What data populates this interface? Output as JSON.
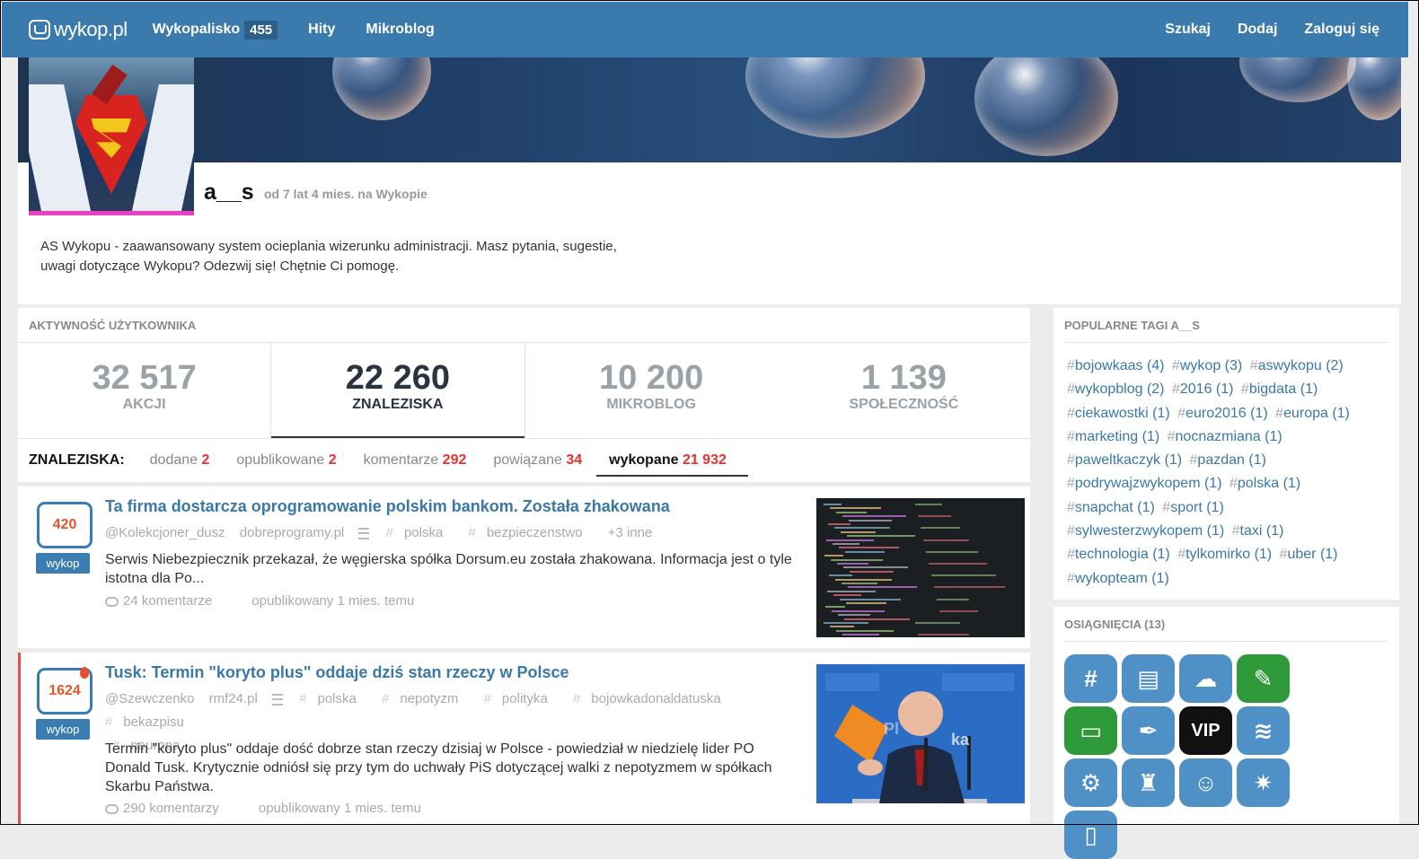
{
  "nav": {
    "logo": "wykop.pl",
    "wykopalisko": "Wykopalisko",
    "wykopalisko_count": "455",
    "hity": "Hity",
    "mikroblog": "Mikroblog",
    "szukaj": "Szukaj",
    "dodaj": "Dodaj",
    "zaloguj": "Zaloguj się"
  },
  "profile": {
    "username": "a__s",
    "member_since": "od 7 lat 4 mies. na Wykopie",
    "bio_line1": "AS Wykopu - zaawansowany system ocieplania wizerunku administracji. Masz pytania, sugestie,",
    "bio_line2": "uwagi dotyczące Wykopu? Odezwij się! Chętnie Ci pomogę."
  },
  "activity": {
    "title": "AKTYWNOŚĆ UŻYTKOWNIKA",
    "stats": [
      {
        "value": "32 517",
        "label": "AKCJI"
      },
      {
        "value": "22 260",
        "label": "ZNALEZISKA"
      },
      {
        "value": "10 200",
        "label": "MIKROBLOG"
      },
      {
        "value": "1 139",
        "label": "SPOŁECZNOŚĆ"
      }
    ],
    "subtabs_label": "ZNALEZISKA:",
    "subtabs": [
      {
        "label": "dodane",
        "count": "2"
      },
      {
        "label": "opublikowane",
        "count": "2"
      },
      {
        "label": "komentarze",
        "count": "292"
      },
      {
        "label": "powiązane",
        "count": "34"
      },
      {
        "label": "wykopane",
        "count": "21 932"
      }
    ]
  },
  "entries": [
    {
      "votes": "420",
      "vote_button": "wykop",
      "title": "Ta firma dostarcza oprogramowanie polskim bankom. Została zhakowana",
      "author": "@Kolekcjoner_dusz",
      "domain": "dobreprogramy.pl",
      "tags": [
        "polska",
        "bezpieczenstwo"
      ],
      "more": "+3 inne",
      "desc": "Serwis Niebezpiecznik przekazał, że węgierska spółka Dorsum.eu została zhakowana. Informacja jest o tyle istotna dla Po...",
      "comments": "24 komentarze",
      "published": "opublikowany 1 mies. temu"
    },
    {
      "votes": "1624",
      "vote_button": "wykop",
      "title": "Tusk: Termin \"koryto plus\" oddaje dziś stan rzeczy w Polsce",
      "author": "@Szewczenko",
      "domain": "rmf24.pl",
      "tags": [
        "polska",
        "nepotyzm",
        "polityka",
        "bojowkadonaldatuska",
        "bekazpisu",
        "neuropa"
      ],
      "desc": "Termin \"koryto plus\" oddaje dość dobrze stan rzeczy dzisiaj w Polsce - powiedział w niedzielę lider PO Donald Tusk. Krytycznie odniósł się przy tym do uchwały PiS dotyczącej walki z nepotyzmem w spółkach Skarbu Państwa.",
      "comments": "290 komentarzy",
      "published": "opublikowany 1 mies. temu"
    }
  ],
  "sidebar": {
    "tags_title": "POPULARNE TAGI A__S",
    "tags": [
      "bojowkaas (4)",
      "wykop (3)",
      "aswykopu (2)",
      "wykopblog (2)",
      "2016 (1)",
      "bigdata (1)",
      "ciekawostki (1)",
      "euro2016 (1)",
      "europa (1)",
      "marketing (1)",
      "nocnazmiana (1)",
      "paweltkaczyk (1)",
      "pazdan (1)",
      "podrywajzwykopem (1)",
      "polska (1)",
      "snapchat (1)",
      "sport (1)",
      "sylwesterzwykopem (1)",
      "taxi (1)",
      "technologia (1)",
      "tylkomirko (1)",
      "uber (1)",
      "wykopteam (1)"
    ],
    "achievements_title": "OSIĄGNIĘCIA (13)",
    "badges": [
      {
        "icon": "hashtag-badge-icon",
        "glyph": "#",
        "color": "#4f90c6"
      },
      {
        "icon": "id-card-badge-icon",
        "glyph": "▤",
        "color": "#4f90c6"
      },
      {
        "icon": "cloud-badge-icon",
        "glyph": "☁",
        "color": "#4f90c6"
      },
      {
        "icon": "pen-badge-icon",
        "glyph": "✎",
        "color": "#2e9a3a"
      },
      {
        "icon": "speech-bubble-badge-icon",
        "glyph": "▭",
        "color": "#2e9a3a"
      },
      {
        "icon": "feather-pen-badge-icon",
        "glyph": "✒",
        "color": "#4f90c6"
      },
      {
        "icon": "vip-badge-icon",
        "glyph": "VIP",
        "color": "#111111"
      },
      {
        "icon": "tornado-badge-icon",
        "glyph": "≋",
        "color": "#4f90c6"
      },
      {
        "icon": "screw-badge-icon",
        "glyph": "⚙",
        "color": "#4f90c6"
      },
      {
        "icon": "beer-badge-icon",
        "glyph": "♜",
        "color": "#4f90c6"
      },
      {
        "icon": "girl-face-badge-icon",
        "glyph": "☺",
        "color": "#4f90c6"
      },
      {
        "icon": "fireworks-badge-icon",
        "glyph": "✷",
        "color": "#4f90c6"
      },
      {
        "icon": "devices-badge-icon",
        "glyph": "▯",
        "color": "#4f90c6"
      }
    ]
  }
}
